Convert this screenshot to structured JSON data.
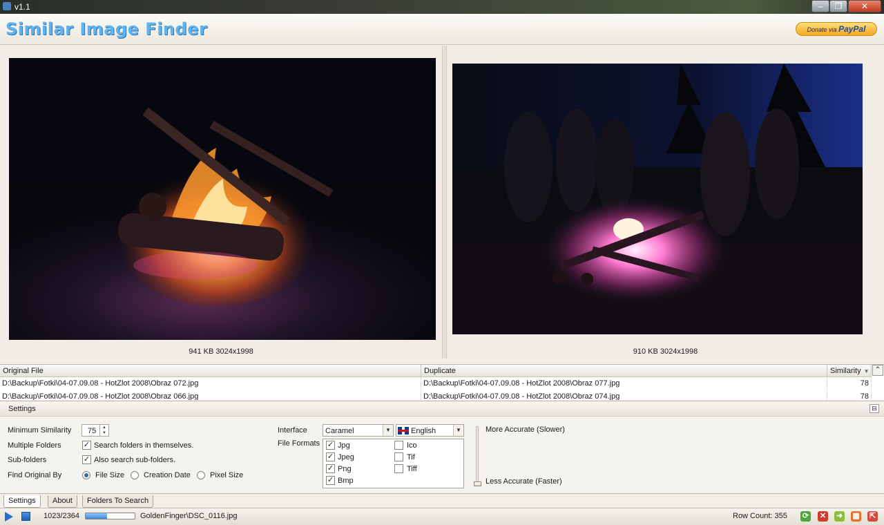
{
  "window": {
    "title": "v1.1",
    "buttons": {
      "minimize": "‒",
      "maximize": "❐",
      "close": "✕"
    }
  },
  "header": {
    "app_name": "Similar Image Finder",
    "donate_prefix": "Donate via",
    "donate_brand": "PayPal"
  },
  "preview": {
    "left": {
      "caption": "941 KB 3024x1998"
    },
    "right": {
      "caption": "910 KB 3024x1998"
    }
  },
  "results": {
    "columns": [
      "Original File",
      "Duplicate",
      "Similarity"
    ],
    "sort_icon": "sort-down-icon",
    "collapse_glyph": "⌃",
    "rows": [
      {
        "original": "D:\\Backup\\Fotki\\04-07.09.08 - HotZlot 2008\\Obraz 072.jpg",
        "duplicate": "D:\\Backup\\Fotki\\04-07.09.08 - HotZlot 2008\\Obraz 077.jpg",
        "similarity": "78"
      },
      {
        "original": "D:\\Backup\\Fotki\\04-07.09.08 - HotZlot 2008\\Obraz 066.jpg",
        "duplicate": "D:\\Backup\\Fotki\\04-07.09.08 - HotZlot 2008\\Obraz 074.jpg",
        "similarity": "78"
      }
    ]
  },
  "settings": {
    "title": "Settings",
    "pin_glyph": "⊟",
    "min_similarity": {
      "label": "Minimum Similarity",
      "value": "75"
    },
    "multiple_folders": {
      "label": "Multiple Folders",
      "option": "Search folders in themselves.",
      "checked": true
    },
    "sub_folders": {
      "label": "Sub-folders",
      "option": "Also search sub-folders.",
      "checked": true
    },
    "find_original_by": {
      "label": "Find Original By",
      "options": [
        "File Size",
        "Creation Date",
        "Pixel Size"
      ],
      "selected": "File Size"
    },
    "interface": {
      "label": "Interface",
      "theme": "Caramel",
      "language": "English"
    },
    "file_formats": {
      "label": "File Formats",
      "items": [
        {
          "name": "Jpg",
          "checked": true
        },
        {
          "name": "Jpeg",
          "checked": true
        },
        {
          "name": "Png",
          "checked": true
        },
        {
          "name": "Bmp",
          "checked": true
        },
        {
          "name": "Ico",
          "checked": false
        },
        {
          "name": "Tif",
          "checked": false
        },
        {
          "name": "Tiff",
          "checked": false
        }
      ]
    },
    "accuracy": {
      "top": "More Accurate (Slower)",
      "bottom": "Less Accurate (Faster)",
      "level": 0
    }
  },
  "tabs": [
    "Settings",
    "About",
    "Folders To Search"
  ],
  "status": {
    "progress_text": "1023/2364",
    "progress_fraction": 0.43,
    "current_file": "GoldenFinger\\DSC_0116.jpg",
    "row_count": "Row Count: 355",
    "icons": [
      "refresh-icon",
      "delete-icon",
      "move-icon",
      "grid-icon",
      "export-icon"
    ]
  },
  "colors": {
    "logo": "#5fb4f0",
    "progress": "#3f88d8",
    "accent": "#2a6fd0"
  }
}
